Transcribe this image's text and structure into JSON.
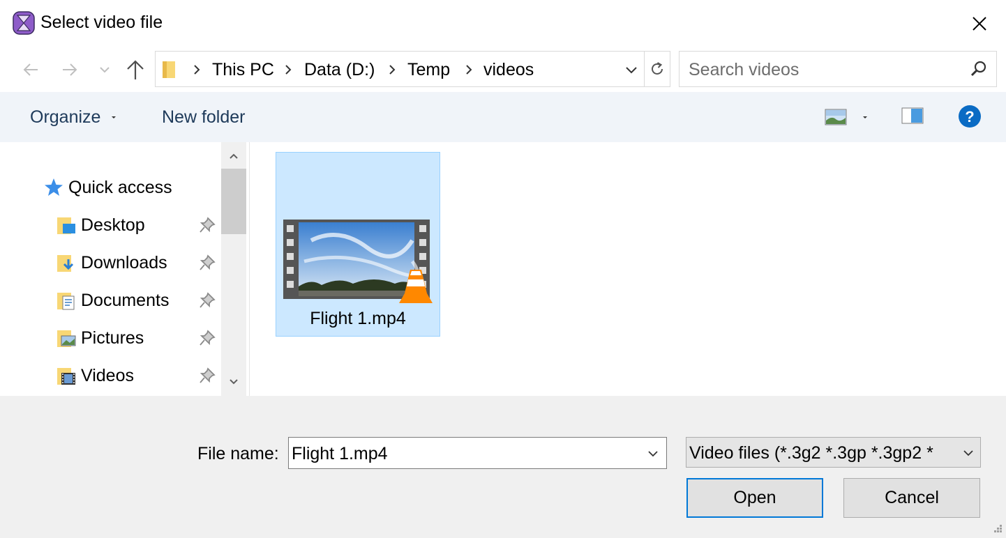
{
  "window": {
    "title": "Select video file"
  },
  "nav": {
    "back_icon": "back-arrow-icon",
    "forward_icon": "forward-arrow-icon",
    "recent_icon": "chevron-down-icon",
    "up_icon": "up-arrow-icon",
    "breadcrumbs": [
      "This PC",
      "Data (D:)",
      "Temp",
      "videos"
    ],
    "search_placeholder": "Search videos"
  },
  "commands": {
    "organize": "Organize",
    "new_folder": "New folder"
  },
  "sidebar": {
    "quick_access": "Quick access",
    "items": [
      {
        "label": "Desktop",
        "icon": "desktop-folder-icon",
        "pinned": true
      },
      {
        "label": "Downloads",
        "icon": "downloads-folder-icon",
        "pinned": true
      },
      {
        "label": "Documents",
        "icon": "documents-folder-icon",
        "pinned": true
      },
      {
        "label": "Pictures",
        "icon": "pictures-folder-icon",
        "pinned": true
      },
      {
        "label": "Videos",
        "icon": "videos-folder-icon",
        "pinned": true
      }
    ]
  },
  "files": [
    {
      "name": "Flight 1.mp4",
      "selected": true,
      "icon": "vlc-video-thumbnail-icon"
    }
  ],
  "bottom": {
    "file_name_label": "File name:",
    "file_name_value": "Flight 1.mp4",
    "filter_value": "Video files (*.3g2 *.3gp *.3gp2 *",
    "open_label": "Open",
    "cancel_label": "Cancel"
  },
  "colors": {
    "accent": "#0078d7",
    "selection": "#cce8ff",
    "selection_border": "#99d1ff",
    "command_bar": "#f0f4f9",
    "command_text": "#1e3a5a",
    "help": "#0a6bc4"
  }
}
